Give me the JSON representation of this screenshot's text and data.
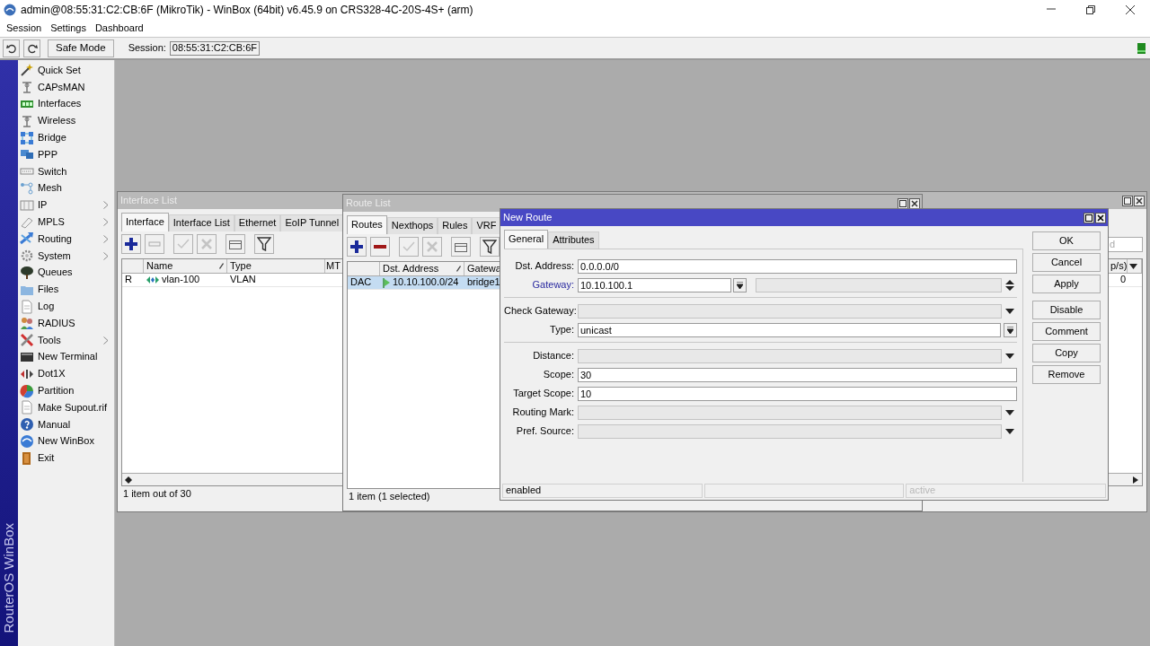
{
  "window": {
    "title": "admin@08:55:31:C2:CB:6F (MikroTik) - WinBox (64bit) v6.45.9 on CRS328-4C-20S-4S+ (arm)"
  },
  "menu": [
    "Session",
    "Settings",
    "Dashboard"
  ],
  "toolbar": {
    "safe_mode": "Safe Mode",
    "session_label": "Session:",
    "session_value": "08:55:31:C2:CB:6F",
    "connected": true
  },
  "brand": "RouterOS WinBox",
  "sidebar": {
    "items": [
      {
        "label": "Quick Set",
        "submenu": false
      },
      {
        "label": "CAPsMAN",
        "submenu": false
      },
      {
        "label": "Interfaces",
        "submenu": false
      },
      {
        "label": "Wireless",
        "submenu": false
      },
      {
        "label": "Bridge",
        "submenu": false
      },
      {
        "label": "PPP",
        "submenu": false
      },
      {
        "label": "Switch",
        "submenu": false
      },
      {
        "label": "Mesh",
        "submenu": false
      },
      {
        "label": "IP",
        "submenu": true
      },
      {
        "label": "MPLS",
        "submenu": true
      },
      {
        "label": "Routing",
        "submenu": true
      },
      {
        "label": "System",
        "submenu": true
      },
      {
        "label": "Queues",
        "submenu": false
      },
      {
        "label": "Files",
        "submenu": false
      },
      {
        "label": "Log",
        "submenu": false
      },
      {
        "label": "RADIUS",
        "submenu": false
      },
      {
        "label": "Tools",
        "submenu": true
      },
      {
        "label": "New Terminal",
        "submenu": false
      },
      {
        "label": "Dot1X",
        "submenu": false
      },
      {
        "label": "Partition",
        "submenu": false
      },
      {
        "label": "Make Supout.rif",
        "submenu": false
      },
      {
        "label": "Manual",
        "submenu": false
      },
      {
        "label": "New WinBox",
        "submenu": false
      },
      {
        "label": "Exit",
        "submenu": false
      }
    ]
  },
  "interface_list": {
    "title": "Interface List",
    "active": false,
    "tabs": [
      {
        "label": "Interface",
        "selected": true
      },
      {
        "label": "Interface List",
        "selected": false
      },
      {
        "label": "Ethernet",
        "selected": false
      },
      {
        "label": "EoIP Tunnel",
        "selected": false
      }
    ],
    "tools": [
      {
        "kind": "add",
        "enabled": true
      },
      {
        "kind": "remove",
        "enabled": false
      },
      {
        "kind": "enable",
        "enabled": false
      },
      {
        "kind": "disable",
        "enabled": false
      },
      {
        "kind": "comment",
        "enabled": true
      },
      {
        "kind": "filter",
        "enabled": true
      }
    ],
    "find": {
      "placeholder": "d"
    },
    "columns": [
      {
        "label": "Name",
        "sorted": true
      },
      {
        "label": "Type",
        "sorted": false
      },
      {
        "label": "MT",
        "sorted": false
      }
    ],
    "last_column": "p/s)",
    "rows": [
      {
        "flag": "R",
        "name": "vlan-100",
        "type": "VLAN",
        "last": "0",
        "selected": false
      }
    ],
    "status": "1 item out of 30"
  },
  "route_list": {
    "title": "Route List",
    "active": false,
    "tabs": [
      {
        "label": "Routes",
        "selected": true
      },
      {
        "label": "Nexthops",
        "selected": false
      },
      {
        "label": "Rules",
        "selected": false
      },
      {
        "label": "VRF",
        "selected": false
      }
    ],
    "tools": [
      {
        "kind": "add",
        "enabled": true
      },
      {
        "kind": "remove",
        "enabled": true
      },
      {
        "kind": "enable",
        "enabled": false
      },
      {
        "kind": "disable",
        "enabled": false
      },
      {
        "kind": "comment",
        "enabled": true
      },
      {
        "kind": "filter",
        "enabled": true
      }
    ],
    "columns": [
      {
        "label": "Dst. Address",
        "sorted": true
      },
      {
        "label": "Gatewa",
        "sorted": false
      }
    ],
    "rows": [
      {
        "flags": "DAC",
        "dst": "10.10.100.0/24",
        "gateway": "bridge1",
        "selected": true
      }
    ],
    "status": "1 item (1 selected)"
  },
  "new_route": {
    "title": "New Route",
    "active": true,
    "tabs": [
      {
        "label": "General",
        "selected": true
      },
      {
        "label": "Attributes",
        "selected": false
      }
    ],
    "groups": [
      [
        {
          "label": "Dst. Address:",
          "kind": "text",
          "value": "0.0.0.0/0",
          "highlight": false
        },
        {
          "label": "Gateway:",
          "kind": "gateway",
          "value": "10.10.100.1",
          "highlight": true
        }
      ],
      [
        {
          "label": "Check Gateway:",
          "kind": "choice",
          "highlight": false
        },
        {
          "label": "Type:",
          "kind": "select",
          "value": "unicast",
          "highlight": false
        }
      ],
      [
        {
          "label": "Distance:",
          "kind": "choice",
          "highlight": false
        },
        {
          "label": "Scope:",
          "kind": "text",
          "value": "30",
          "highlight": false
        },
        {
          "label": "Target Scope:",
          "kind": "text",
          "value": "10",
          "highlight": false
        },
        {
          "label": "Routing Mark:",
          "kind": "choice",
          "highlight": false
        },
        {
          "label": "Pref. Source:",
          "kind": "choice",
          "highlight": false
        }
      ]
    ],
    "buttons": [
      [
        "OK",
        "Cancel",
        "Apply"
      ],
      [
        "Disable",
        "Comment",
        "Copy",
        "Remove"
      ]
    ],
    "status": [
      {
        "text": "enabled",
        "dim": false
      },
      {
        "text": "active",
        "dim": true
      }
    ]
  }
}
